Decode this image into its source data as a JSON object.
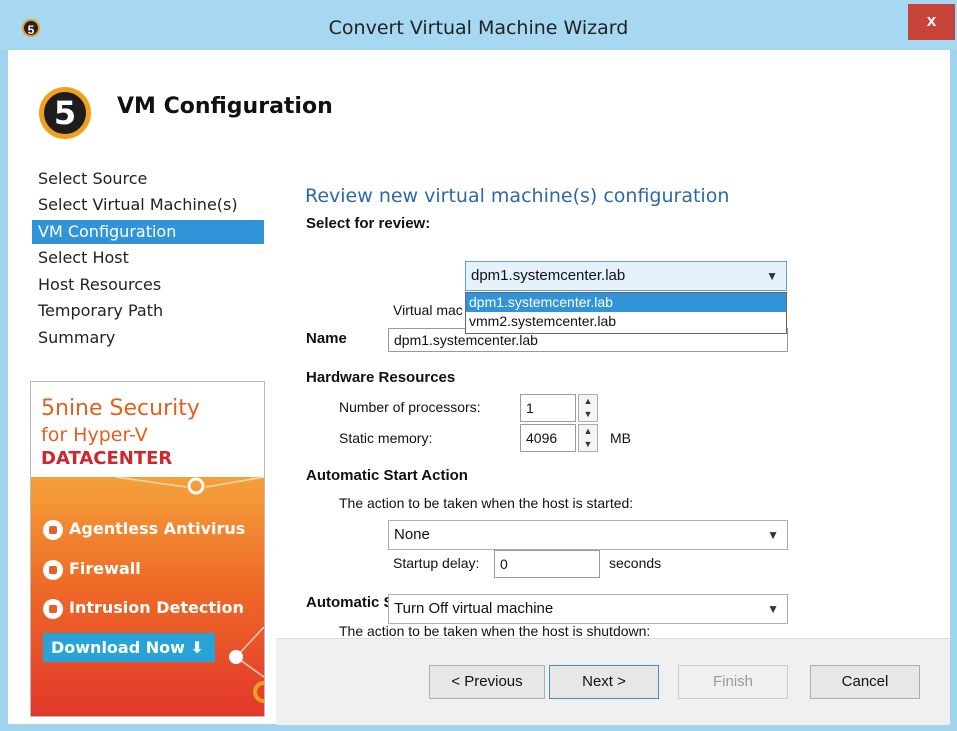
{
  "window": {
    "title": "Convert Virtual Machine Wizard",
    "icon_glyph": "5",
    "close_label": "x"
  },
  "header": {
    "logo_glyph": "5",
    "title": "VM Configuration"
  },
  "nav": {
    "items": [
      {
        "label": "Select Source",
        "active": false
      },
      {
        "label": "Select Virtual Machine(s)",
        "active": false
      },
      {
        "label": "VM Configuration",
        "active": true
      },
      {
        "label": "Select Host",
        "active": false
      },
      {
        "label": "Host Resources",
        "active": false
      },
      {
        "label": "Temporary Path",
        "active": false
      },
      {
        "label": "Summary",
        "active": false
      }
    ]
  },
  "ad": {
    "line1": "5nine Security",
    "line2": "for Hyper-V",
    "line3": "DATACENTER",
    "features": [
      "Agentless Antivirus",
      "Firewall",
      "Intrusion Detection"
    ],
    "download_label": "Download Now"
  },
  "main": {
    "review_title": "Review new virtual machine(s) configuration",
    "select_label": "Select for review:",
    "select_value": "dpm1.systemcenter.lab",
    "dropdown_options": [
      "dpm1.systemcenter.lab",
      "vmm2.systemcenter.lab"
    ],
    "vm_name_caption": "Virtual mac",
    "name_label": "Name",
    "name_value": "dpm1.systemcenter.lab",
    "hardware_label": "Hardware Resources",
    "processors_label": "Number of processors:",
    "processors_value": "1",
    "memory_label": "Static memory:",
    "memory_value": "4096",
    "memory_unit": "MB",
    "start_action_label": "Automatic Start Action",
    "start_action_desc": "The action to be taken when the host is started:",
    "start_action_value": "None",
    "startup_delay_label": "Startup delay:",
    "startup_delay_value": "0",
    "startup_delay_unit": "seconds",
    "stop_action_label": "Automatic Stop Action",
    "stop_action_desc": "The action to be taken when the host is shutdown:",
    "stop_action_value": "Turn Off virtual machine"
  },
  "footer": {
    "previous_label": "< Previous",
    "next_label": "Next >",
    "finish_label": "Finish",
    "cancel_label": "Cancel"
  },
  "colors": {
    "titlebar": "#a7d8f2",
    "accent": "#3294d8",
    "close": "#c7443a",
    "ad_orange": "#ee6b27"
  }
}
